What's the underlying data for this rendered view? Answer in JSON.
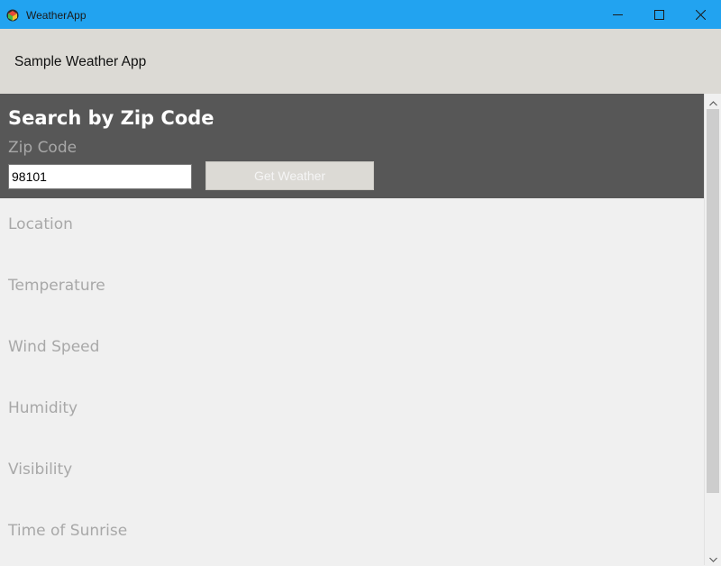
{
  "window": {
    "title": "WeatherApp",
    "icon": "app-logo-icon",
    "controls": [
      "minimize-icon",
      "maximize-icon",
      "close-icon"
    ],
    "titlebar_color": "#22a3f0"
  },
  "header": {
    "title": "Sample Weather App"
  },
  "search": {
    "heading": "Search by Zip Code",
    "zip_label": "Zip Code",
    "zip_value": "98101",
    "button_label": "Get Weather"
  },
  "results": {
    "fields": [
      {
        "label": "Location"
      },
      {
        "label": "Temperature"
      },
      {
        "label": "Wind Speed"
      },
      {
        "label": "Humidity"
      },
      {
        "label": "Visibility"
      },
      {
        "label": "Time of Sunrise"
      }
    ]
  },
  "colors": {
    "panel": "#575757",
    "header": "#dcdad5",
    "muted_text": "#a8a8a8"
  }
}
